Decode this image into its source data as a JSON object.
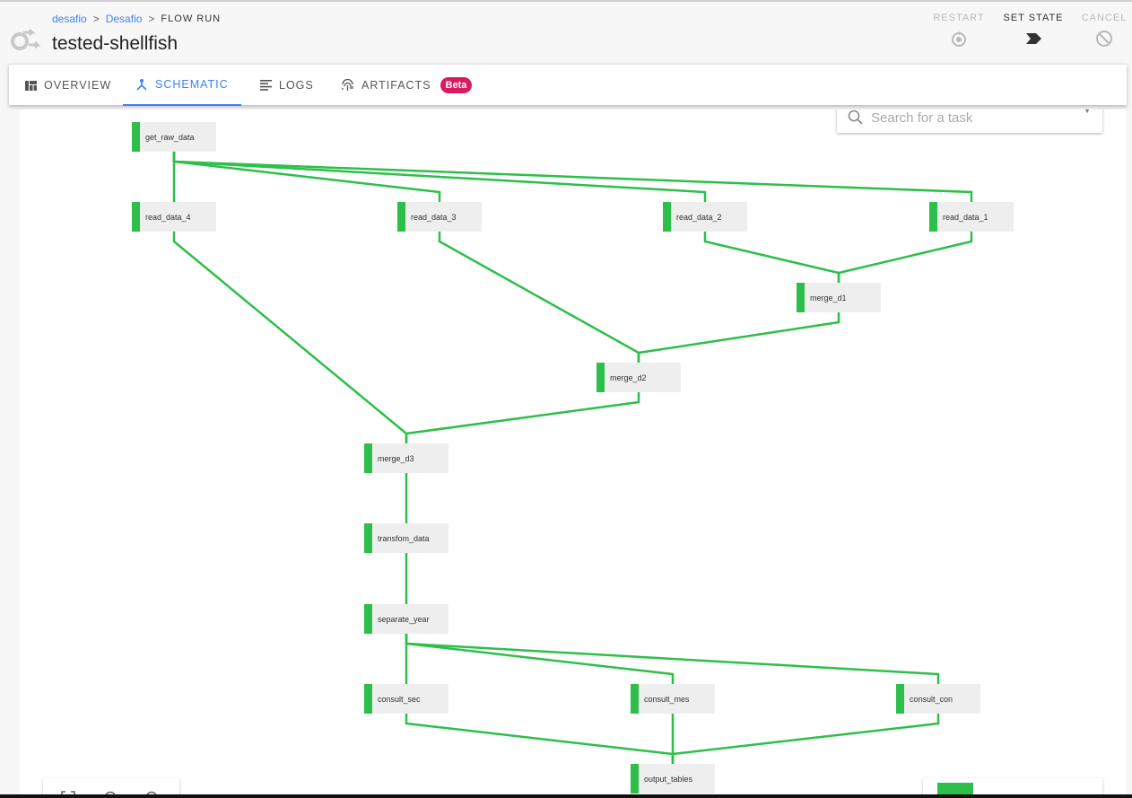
{
  "breadcrumb": {
    "items": [
      "desafio",
      "Desafio"
    ],
    "current": "FLOW RUN"
  },
  "page_title": "tested-shellfish",
  "actions": {
    "restart": "RESTART",
    "set_state": "SET STATE",
    "cancel": "CANCEL"
  },
  "tabs": [
    {
      "label": "OVERVIEW",
      "icon": "dashboard-icon"
    },
    {
      "label": "SCHEMATIC",
      "icon": "schematic-icon"
    },
    {
      "label": "LOGS",
      "icon": "logs-icon"
    },
    {
      "label": "ARTIFACTS",
      "icon": "fingerprint-icon"
    }
  ],
  "beta_badge": "Beta",
  "search": {
    "placeholder": "Search for a task"
  },
  "colors": {
    "success": "#2dbf4a",
    "accent": "#3b82f6",
    "beta": "#d81b60"
  },
  "schematic": {
    "nodes": [
      {
        "id": "get_raw_data",
        "label": "get_raw_data",
        "state": "success"
      },
      {
        "id": "read_data_4",
        "label": "read_data_4",
        "state": "success"
      },
      {
        "id": "read_data_3",
        "label": "read_data_3",
        "state": "success"
      },
      {
        "id": "read_data_2",
        "label": "read_data_2",
        "state": "success"
      },
      {
        "id": "read_data_1",
        "label": "read_data_1",
        "state": "success"
      },
      {
        "id": "merge_d1",
        "label": "merge_d1",
        "state": "success"
      },
      {
        "id": "merge_d2",
        "label": "merge_d2",
        "state": "success"
      },
      {
        "id": "merge_d3",
        "label": "merge_d3",
        "state": "success"
      },
      {
        "id": "transfom_data",
        "label": "transfom_data",
        "state": "success"
      },
      {
        "id": "separate_year",
        "label": "separate_year",
        "state": "success"
      },
      {
        "id": "consult_sec",
        "label": "consult_sec",
        "state": "success"
      },
      {
        "id": "consult_mes",
        "label": "consult_mes",
        "state": "success"
      },
      {
        "id": "consult_con",
        "label": "consult_con",
        "state": "success"
      },
      {
        "id": "output_tables",
        "label": "output_tables",
        "state": "success"
      }
    ],
    "edges": [
      [
        "get_raw_data",
        "read_data_4"
      ],
      [
        "get_raw_data",
        "read_data_3"
      ],
      [
        "get_raw_data",
        "read_data_2"
      ],
      [
        "get_raw_data",
        "read_data_1"
      ],
      [
        "read_data_2",
        "merge_d1"
      ],
      [
        "read_data_1",
        "merge_d1"
      ],
      [
        "read_data_3",
        "merge_d2"
      ],
      [
        "merge_d1",
        "merge_d2"
      ],
      [
        "read_data_4",
        "merge_d3"
      ],
      [
        "merge_d2",
        "merge_d3"
      ],
      [
        "merge_d3",
        "transfom_data"
      ],
      [
        "transfom_data",
        "separate_year"
      ],
      [
        "separate_year",
        "consult_sec"
      ],
      [
        "separate_year",
        "consult_mes"
      ],
      [
        "separate_year",
        "consult_con"
      ],
      [
        "consult_sec",
        "output_tables"
      ],
      [
        "consult_mes",
        "output_tables"
      ],
      [
        "consult_con",
        "output_tables"
      ]
    ]
  }
}
